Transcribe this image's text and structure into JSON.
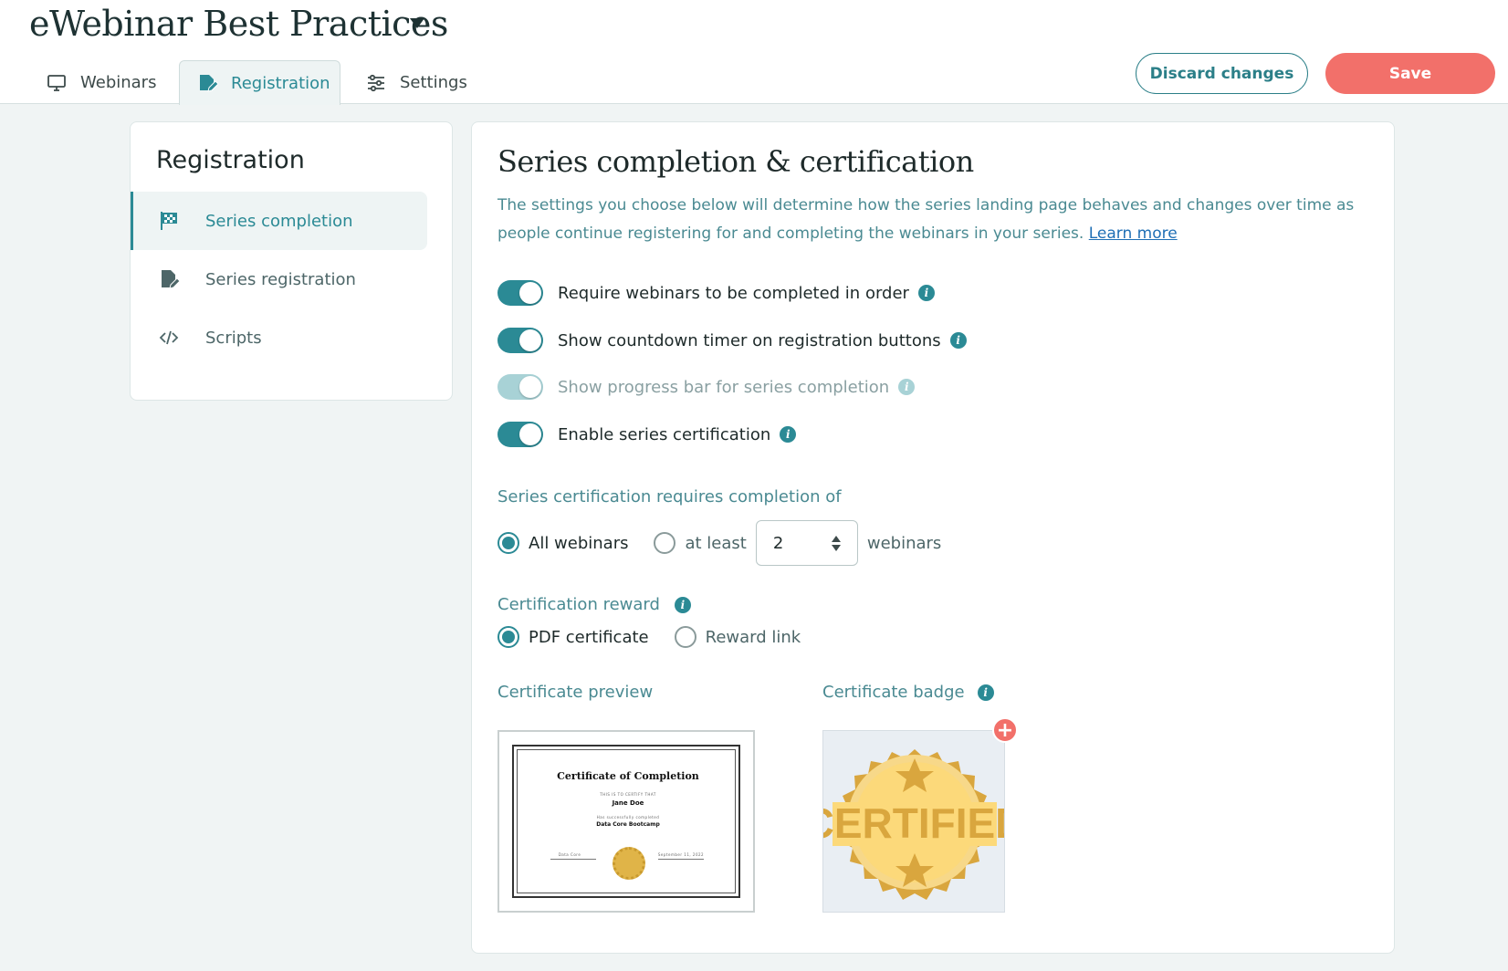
{
  "app": {
    "title": "eWebinar Best Practices"
  },
  "tabs": [
    {
      "label": "Webinars",
      "icon": "monitor-icon"
    },
    {
      "label": "Registration",
      "icon": "edit-document-icon",
      "active": true
    },
    {
      "label": "Settings",
      "icon": "sliders-icon"
    }
  ],
  "actions": {
    "discard_label": "Discard changes",
    "save_label": "Save"
  },
  "colors": {
    "accent": "#2b8a95",
    "save": "#f2706a",
    "badge_gold": "#e0b448"
  },
  "sidebar": {
    "title": "Registration",
    "items": [
      {
        "label": "Series completion",
        "icon": "checkered-flag-icon",
        "active": true
      },
      {
        "label": "Series registration",
        "icon": "edit-document-icon"
      },
      {
        "label": "Scripts",
        "icon": "code-icon"
      }
    ]
  },
  "main": {
    "title": "Series completion & certification",
    "description": "The settings you choose below will determine how the series landing page behaves and changes over time as people continue registering for and completing the webinars in your series.",
    "learn_more": "Learn more",
    "toggles": [
      {
        "label": "Require webinars to be completed in order",
        "on": true,
        "disabled": false
      },
      {
        "label": "Show countdown timer on registration buttons",
        "on": true,
        "disabled": false
      },
      {
        "label": "Show progress bar for series completion",
        "on": true,
        "disabled": true
      },
      {
        "label": "Enable series certification",
        "on": true,
        "disabled": false
      }
    ],
    "requirement": {
      "label": "Series certification requires completion of",
      "all_label": "All webinars",
      "at_least_label": "at least",
      "count": "2",
      "suffix": "webinars",
      "selected": "all"
    },
    "reward": {
      "label": "Certification reward",
      "pdf_label": "PDF certificate",
      "link_label": "Reward link",
      "selected": "pdf"
    },
    "preview": {
      "label": "Certificate preview",
      "heading": "Certificate of Completion",
      "certify_line": "THIS IS TO CERTIFY THAT",
      "name": "Jane Doe",
      "completed_line": "Has successfully completed",
      "course": "Data Core Bootcamp",
      "sign_left": "Data Core",
      "sign_right": "September 11, 2022"
    },
    "badge": {
      "label": "Certificate badge",
      "text": "CERTIFIED"
    }
  }
}
